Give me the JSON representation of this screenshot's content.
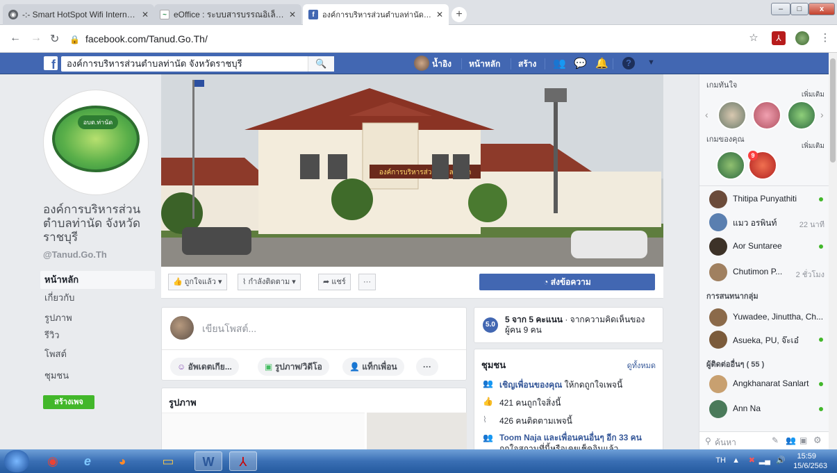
{
  "browser": {
    "tabs": [
      {
        "title": "-:- Smart HotSpot Wifi Internet -:-",
        "icon": "globe-icon"
      },
      {
        "title": "eOffice : ระบบสารบรรณอิเล็กทรอนิกส์",
        "icon": "eoffice-icon"
      },
      {
        "title": "องค์การบริหารส่วนตำบลท่านัด จังหวัดราชบุรี",
        "icon": "facebook-icon"
      }
    ],
    "url": "facebook.com/Tanud.Go.Th/",
    "new_tab": "+",
    "win_min": "–",
    "win_max": "□",
    "win_close": "x"
  },
  "fb": {
    "search_value": "องค์การบริหารส่วนตำบลท่านัด จังหวัดราชบุรี",
    "user_name": "น้ำอิง",
    "nav_home": "หน้าหลัก",
    "nav_create": "สร้าง",
    "brand_color": "#4267b2"
  },
  "page": {
    "avatar_badge": "อบต.ท่านัด",
    "name": "องค์การบริหารส่วนตำบลท่านัด จังหวัดราชบุรี",
    "handle": "@Tanud.Go.Th",
    "nav": [
      "หน้าหลัก",
      "เกี่ยวกับ",
      "รูปภาพ",
      "รีวิว",
      "โพสต์",
      "ชุมชน"
    ],
    "create_page": "สร้างเพจ",
    "cover_sign": "องค์การบริหารส่วนตำบลท่านัด",
    "actions": {
      "liked": "ถูกใจแล้ว ▾",
      "following": "กำลังติดตาม ▾",
      "share": "แชร์",
      "more": "···",
      "send": "ส่งข้อความ"
    }
  },
  "composer": {
    "placeholder": "เขียนโพสต์...",
    "btn_update": "อัพเดตเกีย...",
    "btn_photo": "รูปภาพ/วิดีโอ",
    "btn_tag": "แท็กเพื่อน",
    "btn_more": "···"
  },
  "photos": {
    "title": "รูปภาพ"
  },
  "rating": {
    "score": "5.0",
    "text_bold": "5 จาก 5 คะแนน",
    "text_rest": " · จากความคิดเห็นของผู้คน 9 คน"
  },
  "community": {
    "title": "ชุมชน",
    "see_all": "ดูทั้งหมด",
    "invite_link": "เชิญเพื่อนของคุณ",
    "invite_rest": " ให้กดถูกใจเพจนี้",
    "likes": "421 คนถูกใจสิ่งนี้",
    "follows": "426 คนติดตามเพจนี้",
    "friends_link": "Toom Naja และเพื่อนคนอื่นๆ อีก 33 คน",
    "friends_rest": "ถูกใจสถานที่นี้หรือเคยเช็คอินแล้ว"
  },
  "sidebar": {
    "games_label": "เกมทันใจ",
    "games_more": "เพิ่มเติม",
    "your_games_label": "เกมของคุณ",
    "your_games_more": "เพิ่มเติม",
    "game_badge": "9",
    "contacts": [
      {
        "name": "Thitipa Punyathiti",
        "status": "",
        "online": true,
        "color": "#6b4b3a"
      },
      {
        "name": "แมว อรพินท์",
        "status": "22 นาที",
        "online": false,
        "color": "#5a7fb0"
      },
      {
        "name": "Aor Suntaree",
        "status": "",
        "online": true,
        "color": "#3d3228"
      },
      {
        "name": "Chutimon P...",
        "status": "2 ชั่วโมง",
        "online": false,
        "color": "#a08060"
      }
    ],
    "group_label": "การสนทนากลุ่ม",
    "groups": [
      {
        "name": "Yuwadee, Jinuttha, Ch...",
        "online": false,
        "color": "#8b6a4a"
      },
      {
        "name": "Asueka, PU, จ๊ะเอ๋",
        "online": true,
        "color": "#7b5b3b"
      }
    ],
    "more_contacts_label": "ผู้ติดต่ออื่นๆ ( 55 )",
    "more_contacts": [
      {
        "name": "Angkhanarat Sanlart",
        "online": true,
        "color": "#c8a070"
      },
      {
        "name": "Ann Na",
        "online": true,
        "color": "#4a7a5a"
      }
    ],
    "search_placeholder": "ค้นหา"
  },
  "taskbar": {
    "lang": "TH",
    "time": "15:59",
    "date": "15/6/2563"
  }
}
